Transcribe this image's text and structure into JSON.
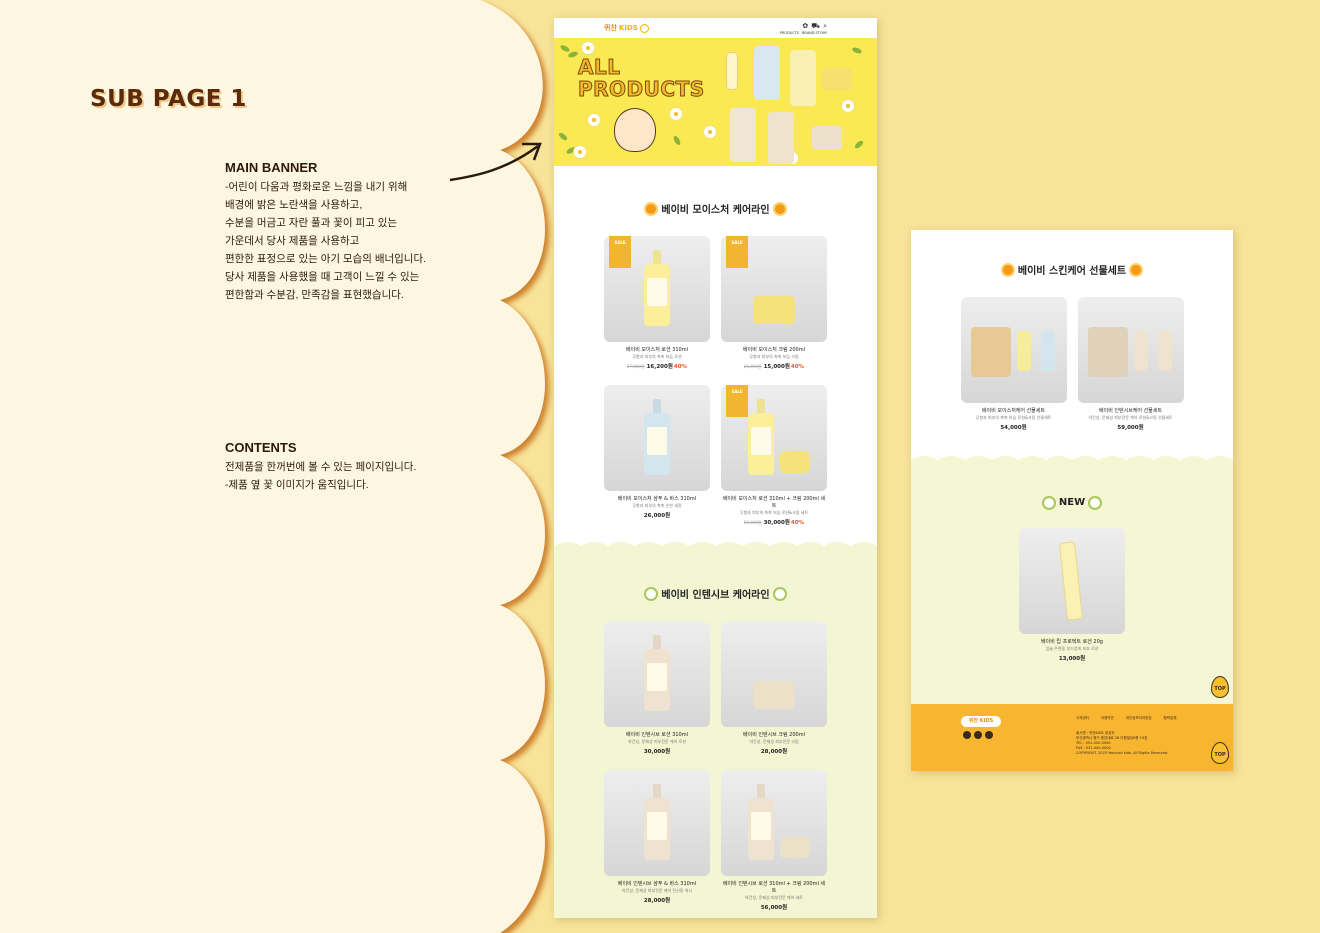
{
  "annotations": {
    "title": "SUB PAGE 1",
    "main_banner_heading": "MAIN BANNER",
    "main_banner_text": "-어린이 다움과 평화로운 느낌을 내기 위해\n배경에 밝은 노란색을 사용하고,\n수분을 머금고 자란 풀과 꽃이 피고 있는\n가운데서 당사 제품을 사용하고\n편한한 표정으로 있는 아기 모습의 배너입니다.\n당사 제품을 사용했을 때 고객이 느낄 수 있는\n 편한함과 수분감, 만족감을 표현했습니다.",
    "contents_heading": "CONTENTS",
    "contents_text": "전제품을 한꺼번에 볼 수 있는 페이지입니다.\n-제품 옆 꽃 이미지가 움직입니다."
  },
  "header": {
    "logo_text": "퀴찬",
    "logo_kids": "KIDS",
    "nav_products": "PRODUCTS",
    "nav_story": "BRAND STORY"
  },
  "banner": {
    "line1": "ALL",
    "line2": "PRODUCTS"
  },
  "moisture": {
    "title": "베이비 모이스처 케어라인",
    "products": [
      {
        "name": "베이비 모이스처 로션 310ml",
        "desc": "무향과 피부의 촉촉 보습 로션",
        "old": "27,000원",
        "price": "16,200원",
        "pct": "40%",
        "badge": "SALE"
      },
      {
        "name": "베이비 모이스처 크림 200ml",
        "desc": "무향과 피부의 촉촉 보습 크림",
        "old": "25,000원",
        "price": "15,000원",
        "pct": "40%",
        "badge": "SALE"
      },
      {
        "name": "베이비 모이스처 샴푸 & 바스 310ml",
        "desc": "무향과 피부의 촉촉 순한 세정",
        "old": "",
        "price": "26,000원",
        "pct": "",
        "badge": ""
      },
      {
        "name": "베이비 모이스처 로션 310ml + 크림 200ml 세트",
        "desc": "무향과 피부의 촉촉 보습 로션&크림 세트",
        "old": "50,000원",
        "price": "30,000원",
        "pct": "40%",
        "badge": "SALE"
      }
    ]
  },
  "intensive": {
    "title": "베이비 인텐시브 케어라인",
    "products": [
      {
        "name": "베이비 인텐시브 로션 310ml",
        "desc": "약건성, 문제성 피부전문 케어 로션",
        "price": "30,000원"
      },
      {
        "name": "베이비 인텐시브 크림 200ml",
        "desc": "약건성, 문제성 피부전문 크림",
        "price": "28,000원"
      },
      {
        "name": "베이비 인텐시브 샴푸 & 바스 310ml",
        "desc": "약건성, 문제성 피부전문 케어 전신용 워시",
        "price": "28,000원"
      },
      {
        "name": "베이비 인텐시브 로션 310ml + 크림 200ml 세트",
        "desc": "약건성, 문제성 피부전문 케어 세트",
        "price": "56,000원"
      }
    ]
  },
  "gift": {
    "title": "베이비 스킨케어 선물세트",
    "products": [
      {
        "name": "베이비 모이스처케어 선물세트",
        "desc": "무향과 피부의 촉촉 보습 로션&크림 선물세트",
        "price": "54,000원"
      },
      {
        "name": "베이비 인텐시브케어 선물세트",
        "desc": "약건성, 문제성 피부전문 케어 로션&크림 선물세트",
        "price": "59,000원"
      }
    ]
  },
  "new": {
    "title": "NEW",
    "product": {
      "name": "베이비 립 프로텍트 로션 20g",
      "desc": "입술 주변을 부드럽게 보호 로션",
      "price": "13,000원"
    }
  },
  "footer": {
    "logo": "퀴찬 KIDS",
    "links": [
      "고객센터",
      "이용약관",
      "개인정보처리방침",
      "협력업체"
    ],
    "info": "회사명 : 퀴찬KIDS 대표자\n부산광역시 중구 중앙대로 26 다원빌딩6층 15호\nTEL : 051-000-0000\nFAX : 051-000-0000\nCOPYRIGHT. 2023 Yenchan kids. All Rights Reserved."
  },
  "top_button": "TOP"
}
